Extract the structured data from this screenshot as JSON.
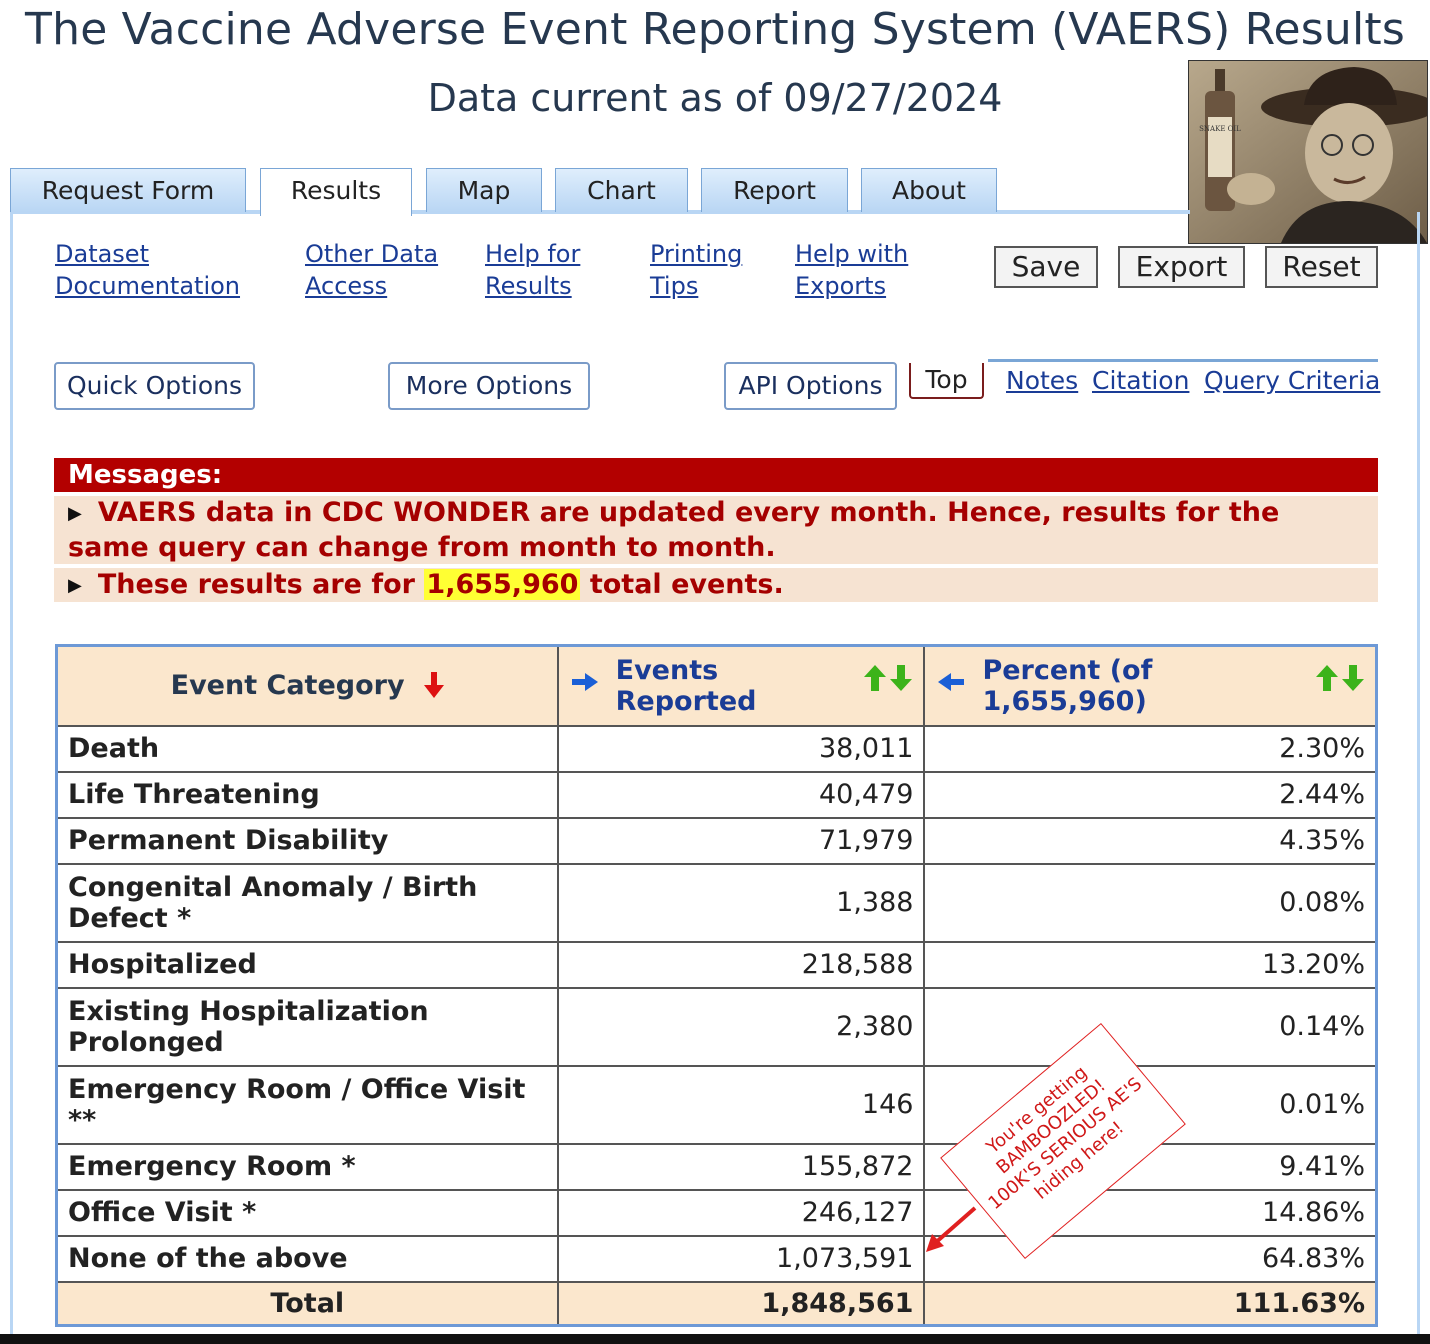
{
  "header": {
    "title": "The Vaccine Adverse Event Reporting System (VAERS) Results",
    "subtitle": "Data current as of 09/27/2024",
    "photo_label": "SNAKE OIL"
  },
  "tabs": [
    {
      "label": "Request Form",
      "active": false
    },
    {
      "label": "Results",
      "active": true
    },
    {
      "label": "Map",
      "active": false
    },
    {
      "label": "Chart",
      "active": false
    },
    {
      "label": "Report",
      "active": false
    },
    {
      "label": "About",
      "active": false
    }
  ],
  "links": [
    {
      "line1": "Dataset",
      "line2": "Documentation"
    },
    {
      "line1": "Other Data",
      "line2": "Access"
    },
    {
      "line1": "Help for",
      "line2": "Results"
    },
    {
      "line1": "Printing",
      "line2": "Tips"
    },
    {
      "line1": "Help with",
      "line2": "Exports"
    }
  ],
  "buttons": {
    "save": "Save",
    "export": "Export",
    "reset": "Reset"
  },
  "options": {
    "quick": "Quick Options",
    "more": "More Options",
    "api": "API Options",
    "top": "Top",
    "notes": "Notes",
    "citation": "Citation",
    "query_criteria": "Query Criteria"
  },
  "messages": {
    "heading": "Messages:",
    "msg1": "VAERS data in CDC WONDER are updated every month. Hence, results for the same query can change from month to month.",
    "msg2_pre": "These results are for",
    "msg2_highlight": "1,655,960",
    "msg2_post": "total events."
  },
  "table": {
    "headers": {
      "category": "Event Category",
      "events_line1": "Events",
      "events_line2": "Reported",
      "percent_line1": "Percent (of",
      "percent_line2": "1,655,960)"
    },
    "rows": [
      {
        "category": "Death",
        "events": "38,011",
        "percent": "2.30%"
      },
      {
        "category": "Life Threatening",
        "events": "40,479",
        "percent": "2.44%"
      },
      {
        "category": "Permanent Disability",
        "events": "71,979",
        "percent": "4.35%"
      },
      {
        "category": "Congenital Anomaly / Birth Defect *",
        "events": "1,388",
        "percent": "0.08%"
      },
      {
        "category": "Hospitalized",
        "events": "218,588",
        "percent": "13.20%"
      },
      {
        "category": "Existing Hospitalization Prolonged",
        "events": "2,380",
        "percent": "0.14%"
      },
      {
        "category": "Emergency Room / Office Visit **",
        "events": "146",
        "percent": "0.01%"
      },
      {
        "category": "Emergency Room *",
        "events": "155,872",
        "percent": "9.41%"
      },
      {
        "category": "Office Visit *",
        "events": "246,127",
        "percent": "14.86%"
      },
      {
        "category": "None of the above",
        "events": "1,073,591",
        "percent": "64.83%"
      }
    ],
    "total": {
      "label": "Total",
      "events": "1,848,561",
      "percent": "111.63%"
    }
  },
  "annotation": {
    "line1": "You're getting",
    "line2": "BAMBOOZLED!",
    "line3": "100K'S SERIOUS AE'S",
    "line4": "hiding here!",
    "color": "#d01818"
  }
}
